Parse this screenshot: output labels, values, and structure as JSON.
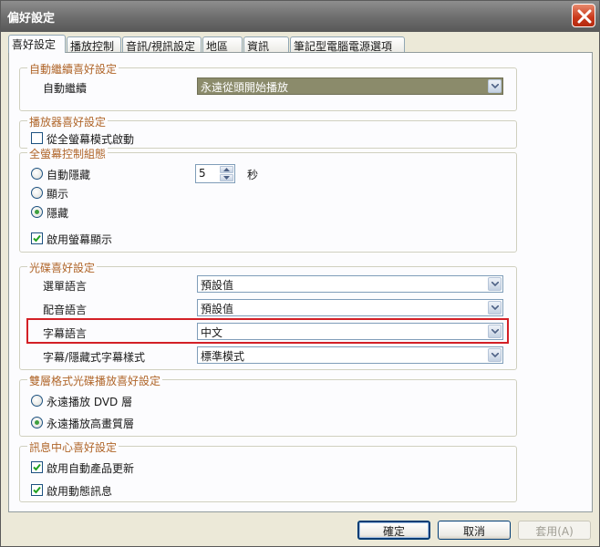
{
  "window": {
    "title": "偏好設定"
  },
  "tabs": [
    "喜好設定",
    "播放控制",
    "音訊/視訊設定",
    "地區",
    "資訊",
    "筆記型電腦電源選項"
  ],
  "groups": {
    "auto_resume": {
      "title": "自動繼續喜好設定",
      "label": "自動繼續",
      "value": "永遠從頭開始播放"
    },
    "player": {
      "title": "播放器喜好設定",
      "fullscreen_start_label": "從全螢幕模式啟動",
      "fullscreen_start_checked": false
    },
    "fullscreen_controls": {
      "title": "全螢幕控制組態",
      "options": [
        "自動隱藏",
        "顯示",
        "隱藏"
      ],
      "selected": "隱藏",
      "seconds_value": "5",
      "seconds_unit": "秒",
      "enable_display_label": "啟用螢幕顯示",
      "enable_display_checked": true
    },
    "disc": {
      "title": "光碟喜好設定",
      "rows": [
        {
          "label": "選單語言",
          "value": "預設值"
        },
        {
          "label": "配音語言",
          "value": "預設值"
        },
        {
          "label": "字幕語言",
          "value": "中文"
        },
        {
          "label": "字幕/隱藏式字幕樣式",
          "value": "標準模式"
        }
      ]
    },
    "dual_layer": {
      "title": "雙層格式光碟播放喜好設定",
      "options": [
        "永遠播放 DVD 層",
        "永遠播放高畫質層"
      ],
      "selected": "永遠播放高畫質層"
    },
    "message_center": {
      "title": "訊息中心喜好設定",
      "auto_update_label": "啟用自動產品更新",
      "auto_update_checked": true,
      "dynamic_msg_label": "啟用動態訊息",
      "dynamic_msg_checked": true
    }
  },
  "buttons": {
    "ok": "確定",
    "cancel": "取消",
    "apply": "套用(A)"
  },
  "colors": {
    "group_title": "#b0662a",
    "highlight_border": "#d32026",
    "check_green": "#3fa03f"
  }
}
